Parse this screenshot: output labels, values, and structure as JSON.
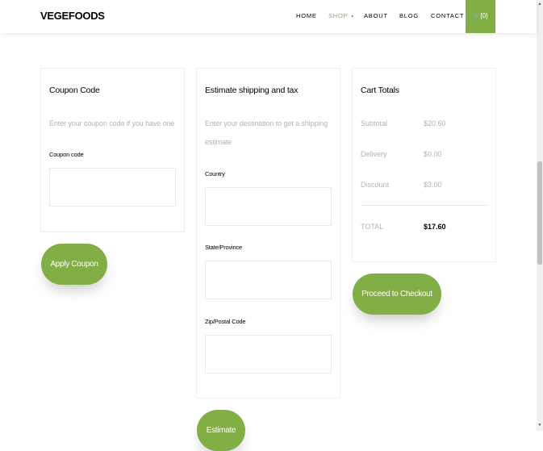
{
  "nav": {
    "brand": "VEGEFOODS",
    "items": [
      "HOME",
      "SHOP",
      "ABOUT",
      "BLOG",
      "CONTACT"
    ],
    "active": "SHOP",
    "cart_label": "[0]",
    "accent": "#82ae46"
  },
  "coupon": {
    "title": "Coupon Code",
    "description": "Enter your coupon code if you have one",
    "field_label": "Coupon code",
    "button": "Apply Coupon"
  },
  "shipping": {
    "title": "Estimate shipping and tax",
    "description_line1": "Enter your destination to get a shipping",
    "description_line2": "estimate",
    "country_label": "Country",
    "state_label": "State/Province",
    "zip_label": "Zip/Postal Code",
    "button": "Estimate"
  },
  "totals": {
    "title": "Cart Totals",
    "subtotal_label": "Subtotal",
    "subtotal_value": "$20.60",
    "delivery_label": "Delivery",
    "delivery_value": "$0.00",
    "discount_label": "Discount",
    "discount_value": "$3.00",
    "total_label": "TOTAL",
    "total_value": "$17.60",
    "button": "Proceed to Checkout"
  }
}
